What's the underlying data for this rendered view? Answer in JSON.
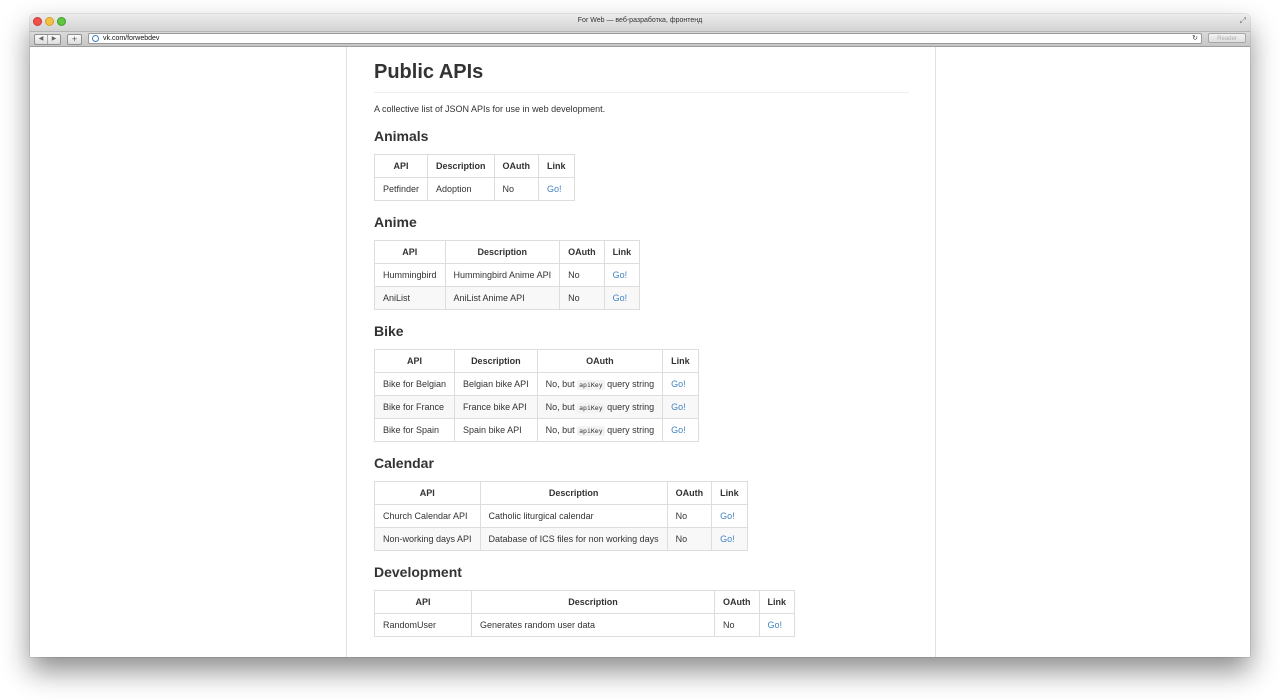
{
  "window": {
    "title": "For Web — веб-разработка, фронтенд",
    "url": "vk.com/forwebdev",
    "reader_label": "Reader"
  },
  "page": {
    "title": "Public APIs",
    "description": "A collective list of JSON APIs for use in web development."
  },
  "headers": {
    "api": "API",
    "description": "Description",
    "oauth": "OAuth",
    "link": "Link"
  },
  "sections": {
    "animals": {
      "title": "Animals",
      "rows": [
        {
          "api": "Petfinder",
          "description": "Adoption",
          "oauth": "No",
          "link": "Go!"
        }
      ]
    },
    "anime": {
      "title": "Anime",
      "rows": [
        {
          "api": "Hummingbird",
          "description": "Hummingbird Anime API",
          "oauth": "No",
          "link": "Go!"
        },
        {
          "api": "AniList",
          "description": "AniList Anime API",
          "oauth": "No",
          "link": "Go!"
        }
      ]
    },
    "bike": {
      "title": "Bike",
      "rows": [
        {
          "api": "Bike for Belgian",
          "description": "Belgian bike API",
          "oauth_prefix": "No, but",
          "oauth_code": "apiKey",
          "oauth_suffix": "query string",
          "link": "Go!"
        },
        {
          "api": "Bike for France",
          "description": "France bike API",
          "oauth_prefix": "No, but",
          "oauth_code": "apiKey",
          "oauth_suffix": "query string",
          "link": "Go!"
        },
        {
          "api": "Bike for Spain",
          "description": "Spain bike API",
          "oauth_prefix": "No, but",
          "oauth_code": "apiKey",
          "oauth_suffix": "query string",
          "link": "Go!"
        }
      ]
    },
    "calendar": {
      "title": "Calendar",
      "rows": [
        {
          "api": "Church Calendar API",
          "description": "Catholic liturgical calendar",
          "oauth": "No",
          "link": "Go!"
        },
        {
          "api": "Non-working days API",
          "description": "Database of ICS files for non working days",
          "oauth": "No",
          "link": "Go!"
        }
      ]
    },
    "development": {
      "title": "Development",
      "rows": [
        {
          "api": "RandomUser",
          "description": "Generates random user data",
          "oauth": "No",
          "link": "Go!"
        }
      ]
    }
  },
  "colors": {
    "link": "#4183c4",
    "text": "#333333",
    "border": "#dddddd"
  },
  "icons": [
    "back-icon",
    "forward-icon",
    "plus-icon",
    "globe-icon",
    "reload-icon",
    "fullscreen-icon"
  ]
}
